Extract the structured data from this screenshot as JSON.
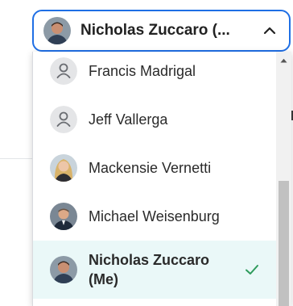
{
  "selector": {
    "display_name": "Nicholas Zuccaro (...",
    "caret_icon": "chevron-up-icon",
    "border_color": "#1f6fe5"
  },
  "people": [
    {
      "name": "Francis Madrigal",
      "avatar": "user-placeholder-icon",
      "selected": false
    },
    {
      "name": "Jeff Vallerga",
      "avatar": "user-placeholder-icon",
      "selected": false
    },
    {
      "name": "Mackensie Vernetti",
      "avatar": "profile-photo",
      "selected": false
    },
    {
      "name": "Michael Weisenburg",
      "avatar": "profile-photo",
      "selected": false
    },
    {
      "name": "Nicholas Zuccaro (Me)",
      "avatar": "profile-photo",
      "selected": true
    }
  ],
  "colors": {
    "selected_background": "#eaf8f8",
    "check_color": "#2e9b5c"
  }
}
